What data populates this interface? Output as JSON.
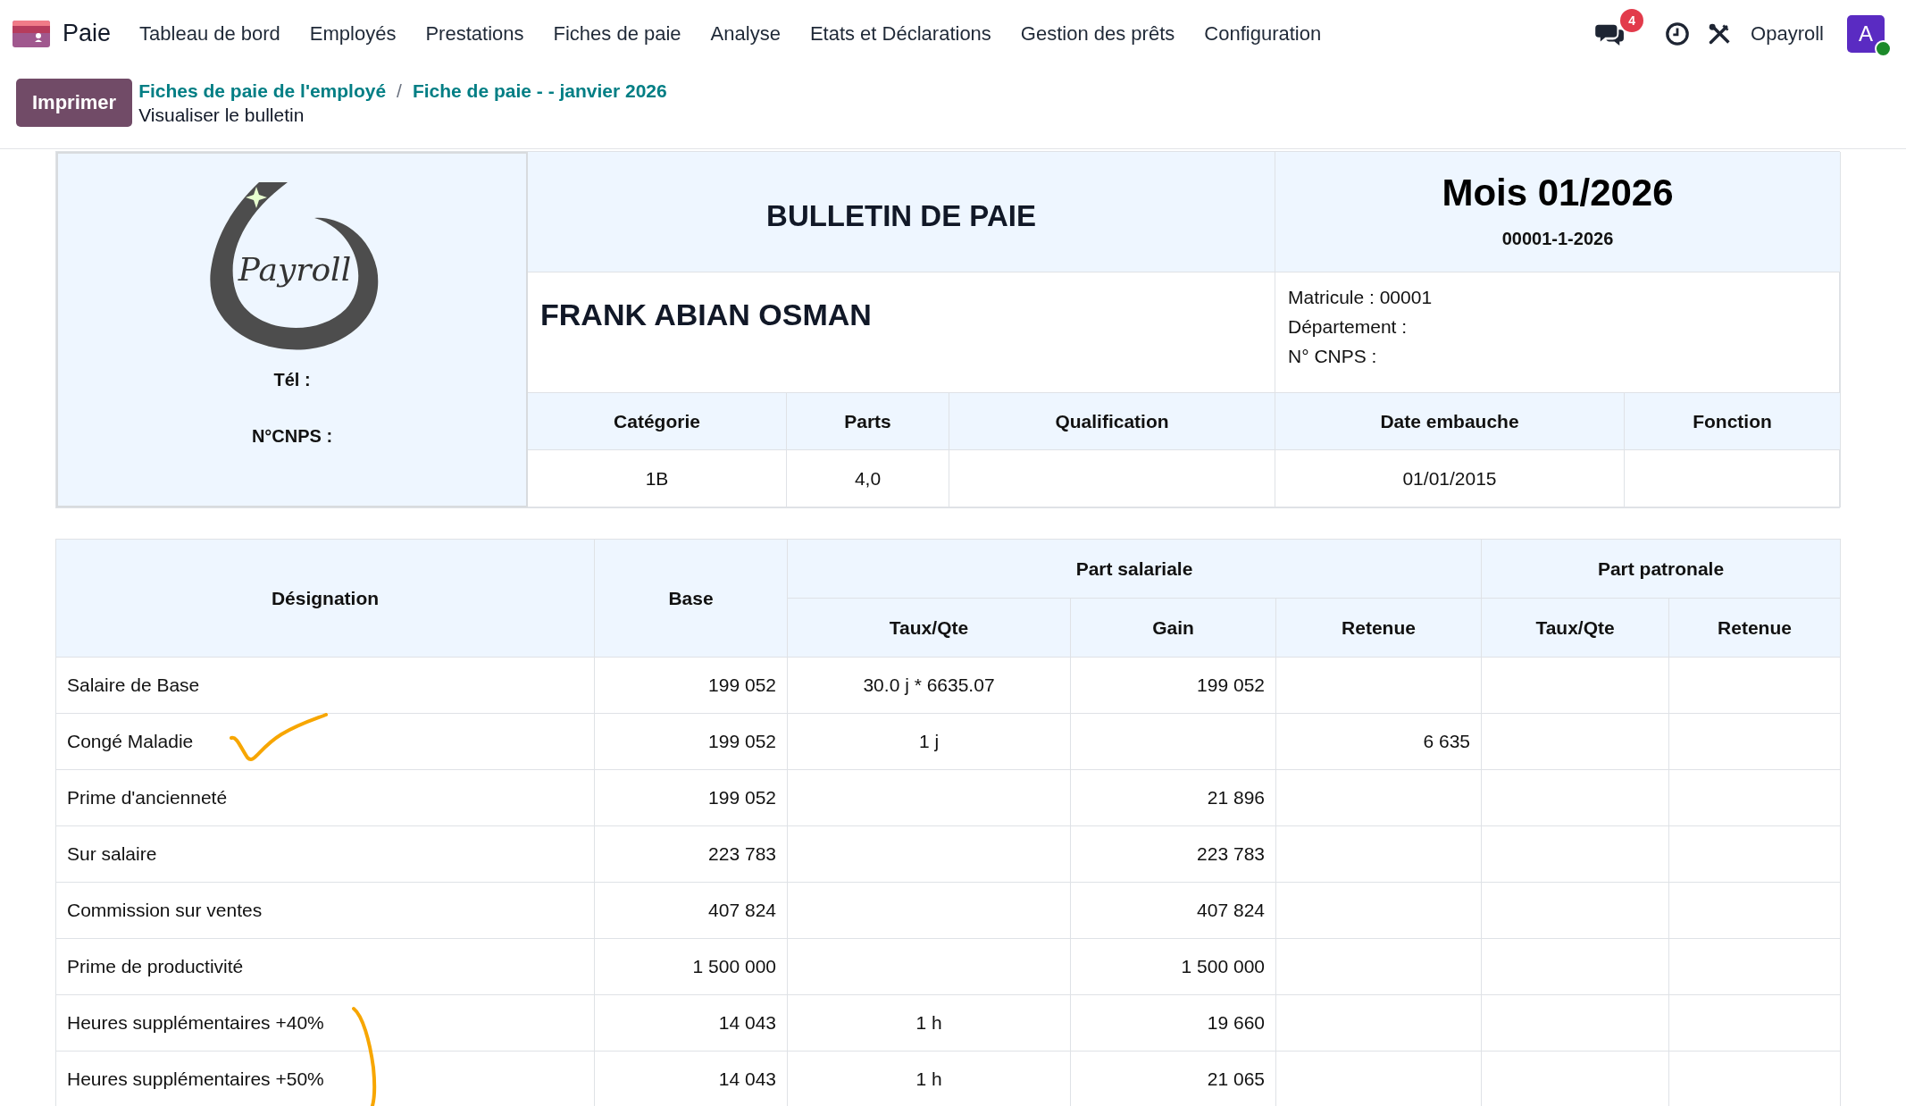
{
  "app": {
    "name": "Paie"
  },
  "menu": [
    "Tableau de bord",
    "Employés",
    "Prestations",
    "Fiches de paie",
    "Analyse",
    "Etats et Déclarations",
    "Gestion des prêts",
    "Configuration"
  ],
  "systray": {
    "messages_badge": "4",
    "user": "Opayroll",
    "avatar": {
      "letter": "A",
      "online": true
    }
  },
  "control_panel": {
    "print_button": "Imprimer",
    "breadcrumb_separator": "/",
    "breadcrumbs": [
      "Fiches de paie de l'employé",
      "Fiche de paie - - janvier 2026"
    ],
    "subtitle": "Visualiser le bulletin"
  },
  "header": {
    "logo_text": "Payroll",
    "company_lines": [
      "Tél :",
      "N°CNPS :"
    ],
    "title": "BULLETIN DE PAIE",
    "month": "Mois 01/2026",
    "reference": "00001-1-2026",
    "employee_name": "FRANK ABIAN OSMAN",
    "employee_info": [
      "Matricule : 00001",
      "Département :",
      "N° CNPS :"
    ],
    "details": [
      {
        "label": "Catégorie",
        "value": "1B"
      },
      {
        "label": "Parts",
        "value": "4,0"
      },
      {
        "label": "Qualification"
      },
      {
        "label": "Date embauche",
        "value": "01/01/2015"
      },
      {
        "label": "Fonction"
      }
    ]
  },
  "lines_table": {
    "designation": "Désignation",
    "base": "Base",
    "employee_group": "Part salariale",
    "employer_group": "Part patronale",
    "employee_columns": [
      "Taux/Qte",
      "Gain",
      "Retenue"
    ],
    "employer_columns": [
      "Taux/Qte",
      "Retenue"
    ],
    "rows": [
      {
        "designation": "Salaire de Base",
        "base": "199 052",
        "rate": "30.0 j * 6635.07",
        "gain": "199 052"
      },
      {
        "designation": "Congé Maladie",
        "base": "199 052",
        "rate": "1 j",
        "deduction": "6 635"
      },
      {
        "designation": "Prime d'ancienneté",
        "base": "199 052",
        "gain": "21 896"
      },
      {
        "designation": "Sur salaire",
        "base": "223 783",
        "gain": "223 783"
      },
      {
        "designation": "Commission sur ventes",
        "base": "407 824",
        "gain": "407 824"
      },
      {
        "designation": "Prime de productivité",
        "base": "1 500 000",
        "gain": "1 500 000"
      },
      {
        "designation": "Heures supplémentaires +40%",
        "base": "14 043",
        "rate": "1 h",
        "gain": "19 660"
      },
      {
        "designation": "Heures supplémentaires +50%",
        "base": "14 043",
        "rate": "1 h",
        "gain": "21 065"
      }
    ]
  }
}
